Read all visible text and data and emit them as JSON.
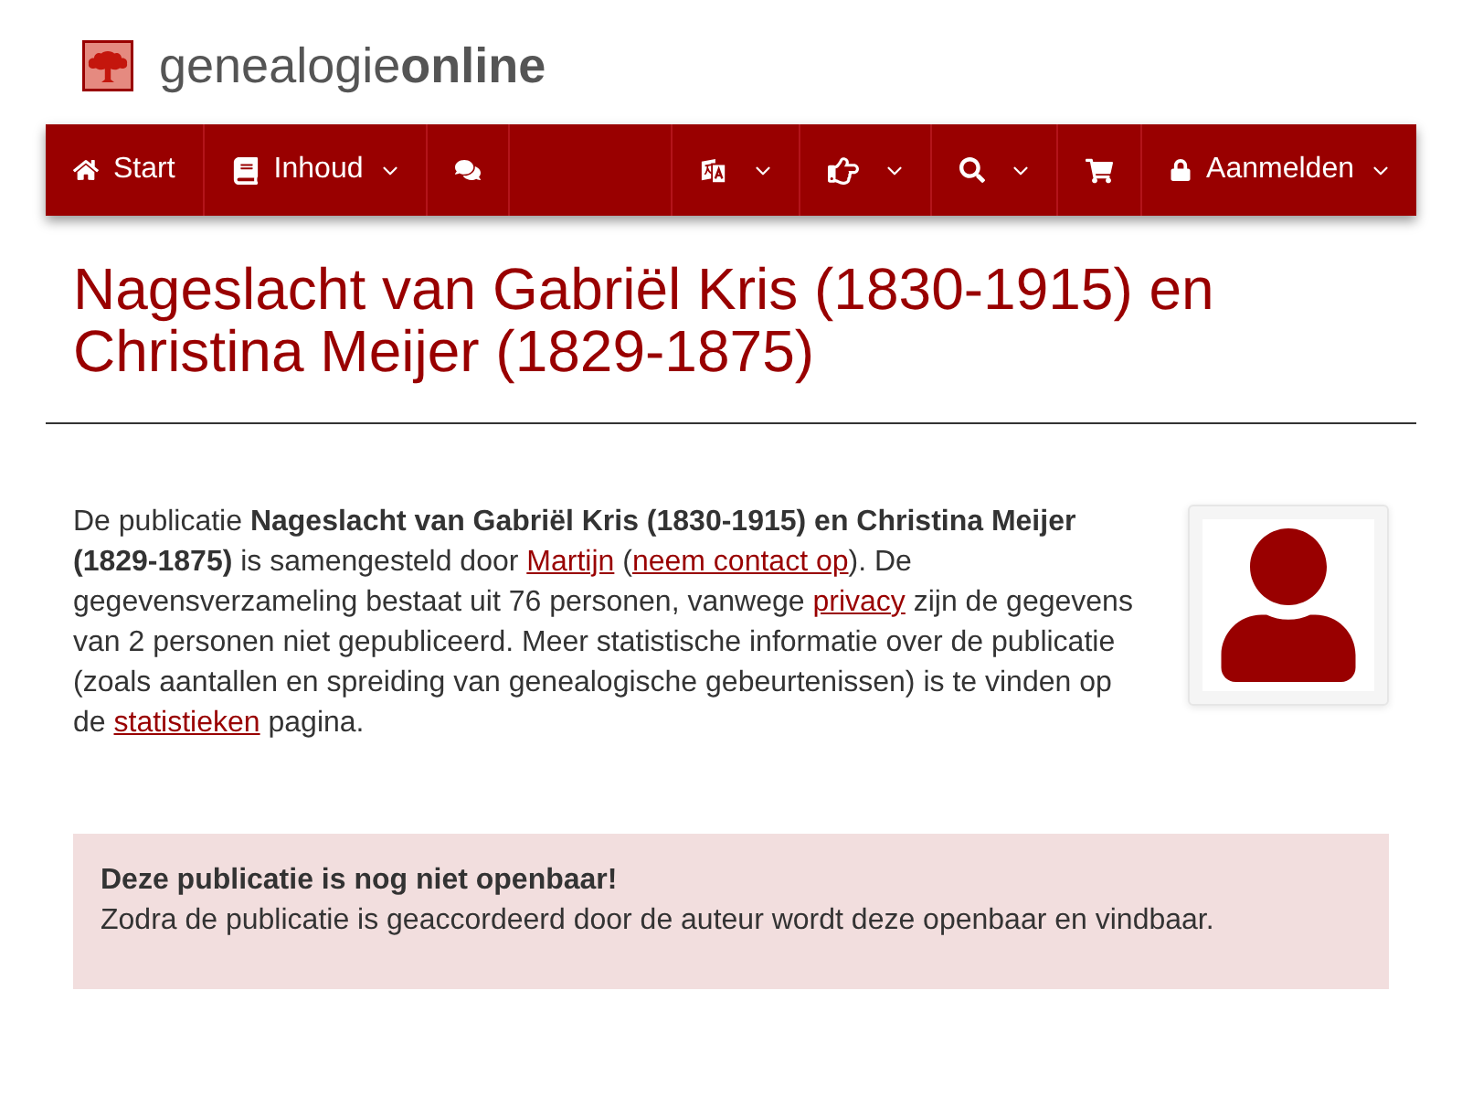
{
  "logo": {
    "text": "genealogie**online**"
  },
  "nav": {
    "left": [
      {
        "label": "Start",
        "dropdown": false
      },
      {
        "label": "Inhoud",
        "dropdown": true
      },
      {
        "dropdown": false
      }
    ],
    "right": [
      {
        "dropdown": true
      },
      {
        "dropdown": true
      },
      {
        "dropdown": true
      },
      {
        "dropdown": false
      },
      {
        "label": "Aanmelden",
        "dropdown": true
      }
    ]
  },
  "title": "Nageslacht van Gabriël Kris (1830-1915) en Christina Meijer (1829-1875)",
  "description": [
    {
      "kind": "text",
      "text": "De publicatie **Nageslacht van Gabriël Kris (1830-1915) en Christina Meijer (1829-1875)** is samengesteld door "
    },
    {
      "kind": "link",
      "text": "Martijn"
    },
    {
      "kind": "text",
      "text": " ("
    },
    {
      "kind": "link",
      "text": "neem contact op"
    },
    {
      "kind": "text",
      "text": "). De gegevensverzameling bestaat uit 76 personen, vanwege "
    },
    {
      "kind": "link",
      "text": "privacy"
    },
    {
      "kind": "text",
      "text": " zijn de gegevens van 2 personen niet gepubliceerd. Meer statistische informatie over de publicatie (zoals aantallen en spreiding van genealogische gebeurtenissen) is te vinden op de "
    },
    {
      "kind": "link",
      "text": "statistieken"
    },
    {
      "kind": "text",
      "text": " pagina."
    }
  ],
  "notice": {
    "title": "Deze publicatie is nog niet openbaar!",
    "text": "Zodra de publicatie is geaccordeerd door de auteur wordt deze openbaar en vindbaar."
  }
}
